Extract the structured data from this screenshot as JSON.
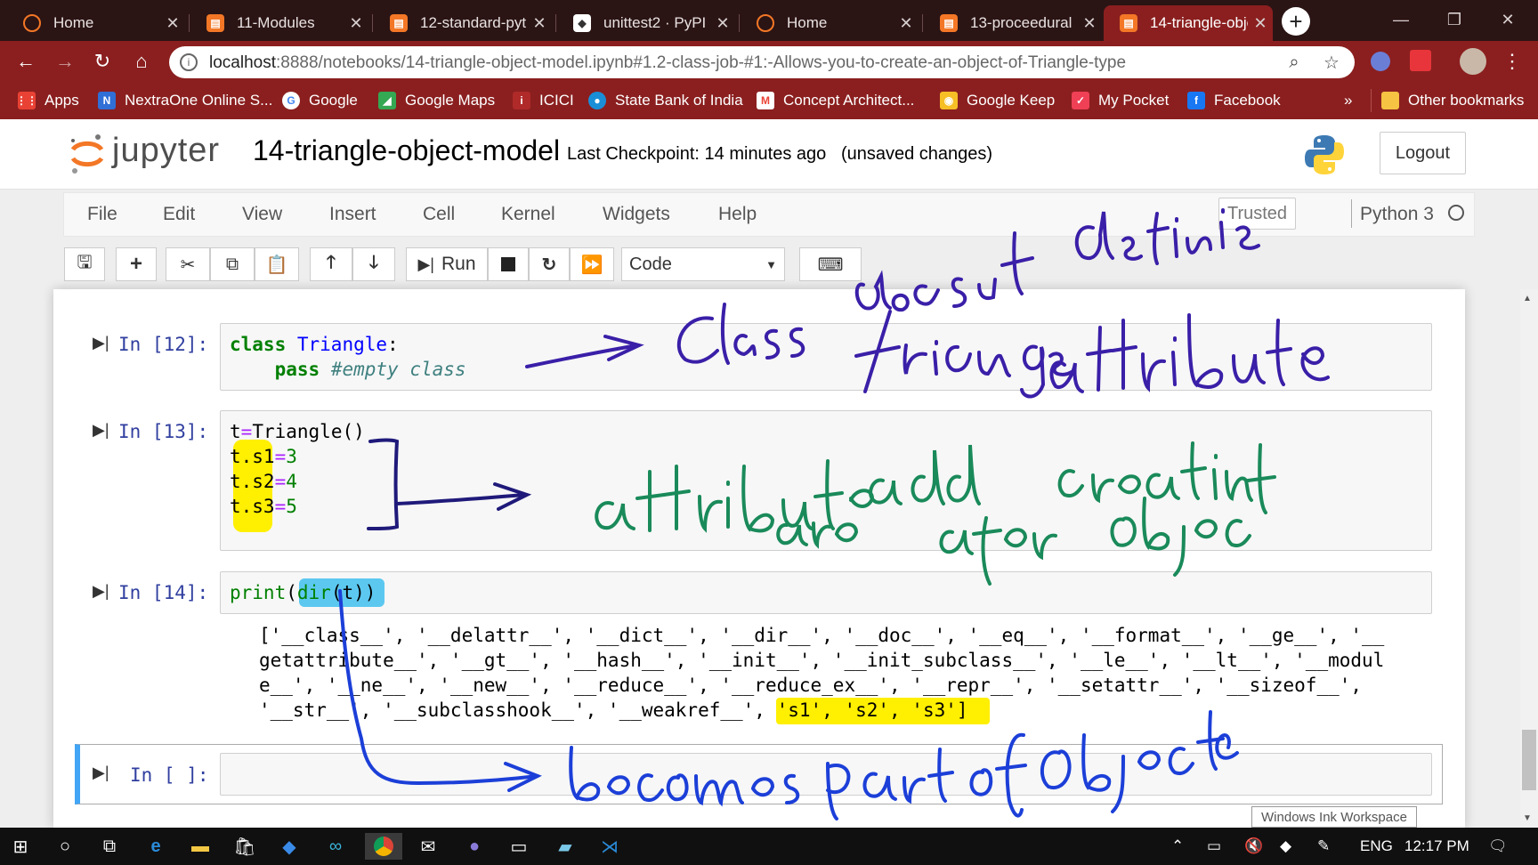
{
  "browser": {
    "tabs": [
      {
        "title": "Home",
        "icon": "jupyter-icon",
        "active": false
      },
      {
        "title": "11-Modules",
        "icon": "notebook-icon",
        "active": false
      },
      {
        "title": "12-standard-pyt",
        "icon": "notebook-icon",
        "active": false
      },
      {
        "title": "unittest2 · PyPI",
        "icon": "pypi-icon",
        "active": false
      },
      {
        "title": "Home",
        "icon": "jupyter-icon",
        "active": false
      },
      {
        "title": "13-proceedural",
        "icon": "notebook-icon",
        "active": false
      },
      {
        "title": "14-triangle-obje",
        "icon": "notebook-icon",
        "active": true
      }
    ],
    "url_host": "localhost",
    "url_path": ":8888/notebooks/14-triangle-object-model.ipynb#1.2-class-job-#1:-Allows-you-to-create-an-object-of-Triangle-type",
    "bookmarks": [
      {
        "label": "Apps",
        "icon": "apps-icon",
        "color": "#e94235"
      },
      {
        "label": "NextraOne Online S...",
        "icon": "nextraone-icon",
        "color": "#2f6fd6"
      },
      {
        "label": "Google",
        "icon": "google-icon",
        "color": "#ffffff"
      },
      {
        "label": "Google Maps",
        "icon": "maps-icon",
        "color": "#34a853"
      },
      {
        "label": "ICICI",
        "icon": "icici-icon",
        "color": "#b02a2a"
      },
      {
        "label": "State Bank of India",
        "icon": "sbi-icon",
        "color": "#1a8fd8"
      },
      {
        "label": "Concept Architect...",
        "icon": "gmail-icon",
        "color": "#ea4335"
      },
      {
        "label": "Google Keep",
        "icon": "keep-icon",
        "color": "#f6bf26"
      },
      {
        "label": "My Pocket",
        "icon": "pocket-icon",
        "color": "#ef4056"
      },
      {
        "label": "Facebook",
        "icon": "facebook-icon",
        "color": "#1877f2"
      }
    ],
    "bookmarks_overflow": "»",
    "other_bookmarks": "Other bookmarks"
  },
  "jupyter": {
    "logo_text": "jupyter",
    "notebook_name": "14-triangle-object-model",
    "checkpoint": "Last Checkpoint: 14 minutes ago",
    "unsaved": "(unsaved changes)",
    "logout_label": "Logout",
    "menus": [
      "File",
      "Edit",
      "View",
      "Insert",
      "Cell",
      "Kernel",
      "Widgets",
      "Help"
    ],
    "trusted_label": "Trusted",
    "kernel_name": "Python 3",
    "run_label": "Run",
    "cell_type": "Code"
  },
  "cells": [
    {
      "prompt": "In [12]:",
      "lines": [
        "class Triangle:",
        "    pass #empty class"
      ]
    },
    {
      "prompt": "In [13]:",
      "lines": [
        "t=Triangle()",
        "t.s1=3",
        "t.s2=4",
        "t.s3=5"
      ]
    },
    {
      "prompt": "In [14]:",
      "lines": [
        "print(dir(t))"
      ],
      "output": [
        "['__class__', '__delattr__', '__dict__', '__dir__', '__doc__', '__eq__', '__format__', '__ge__', '__",
        "getattribute__', '__gt__', '__hash__', '__init__', '__init_subclass__', '__le__', '__lt__', '__modul",
        "e__', '__ne__', '__new__', '__reduce__', '__reduce_ex__', '__repr__', '__setattr__', '__sizeof__',",
        "'__str__', '__subclasshook__', '__weakref__', 's1', 's2', 's3']"
      ]
    },
    {
      "prompt": "In [ ]:",
      "lines": [
        ""
      ]
    }
  ],
  "ink_tooltip": "Windows Ink Workspace",
  "annotations": {
    "note1": "Class doesnt define triangle attributes",
    "note2": "attributes are add after creating object",
    "note3": "becomes part of object"
  },
  "taskbar": {
    "language": "ENG",
    "time": "12:17 PM"
  }
}
